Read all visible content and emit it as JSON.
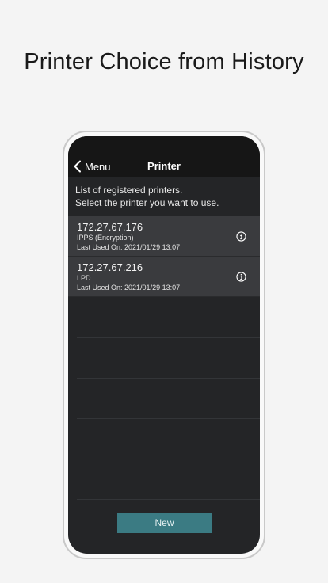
{
  "headline": "Printer Choice from History",
  "navbar": {
    "back_label": "Menu",
    "title": "Printer"
  },
  "intro": {
    "line1": "List of registered printers.",
    "line2": "Select the printer you want to use."
  },
  "printers": [
    {
      "ip": "172.27.67.176",
      "protocol": "IPPS (Encryption)",
      "last_used": "Last Used On: 2021/01/29 13:07"
    },
    {
      "ip": "172.27.67.216",
      "protocol": "LPD",
      "last_used": "Last Used On: 2021/01/29 13:07"
    }
  ],
  "new_button": "New",
  "colors": {
    "background": "#f4f4f4",
    "screen": "#242527",
    "navbar": "#161616",
    "row": "#3a3b3e",
    "accent_button": "#3b7b83"
  },
  "icons": {
    "back": "chevron-left-icon",
    "info": "info-circle-icon"
  }
}
